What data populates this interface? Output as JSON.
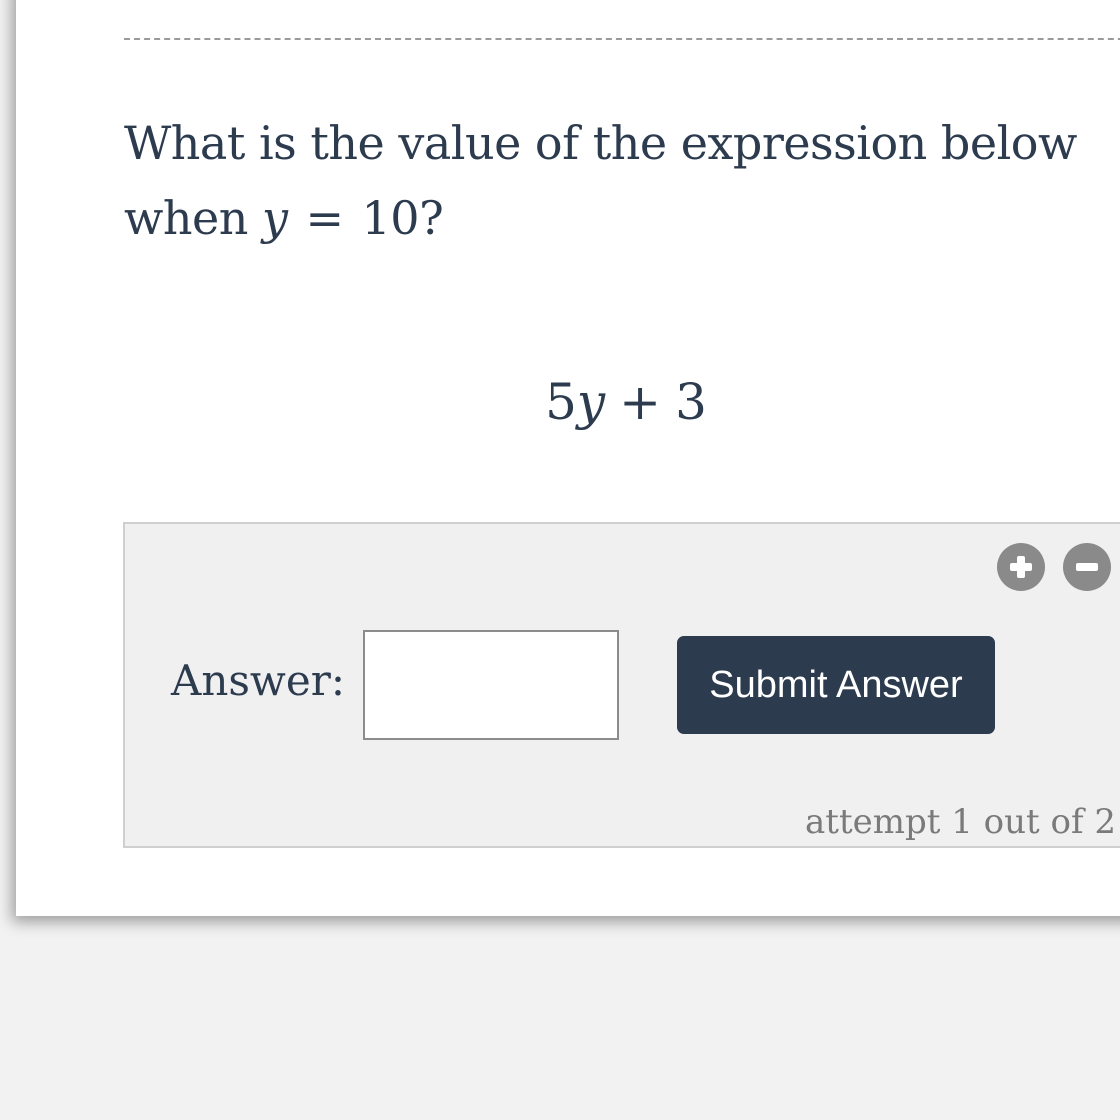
{
  "question": {
    "text_before": "What is the value of the expression below when",
    "variable": "y",
    "equals": "=",
    "value": "10",
    "punct": "?"
  },
  "expression": {
    "coefficient": "5",
    "variable": "y",
    "operator": "+",
    "constant": "3"
  },
  "answer_panel": {
    "zoom_in_icon": "plus-circle-icon",
    "zoom_out_icon": "minus-circle-icon",
    "label": "Answer:",
    "input_value": "",
    "submit_label": "Submit Answer",
    "attempt_text": "attempt 1 out of 2"
  },
  "colors": {
    "text": "#2d3b4f",
    "button_bg": "#2d3b4f",
    "icon_gray": "#8a8a8a",
    "panel_bg": "#f0f0f0"
  }
}
